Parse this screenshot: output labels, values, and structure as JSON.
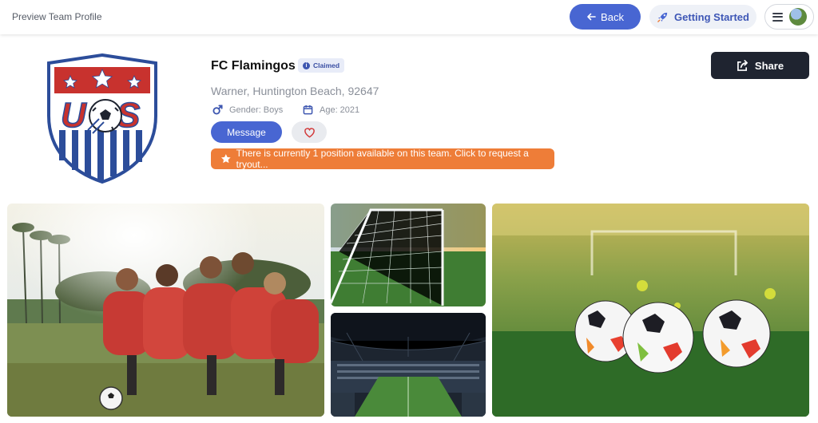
{
  "header": {
    "title": "Preview Team Profile",
    "back_label": "Back",
    "getting_started_label": "Getting Started"
  },
  "team": {
    "name": "FC Flamingos",
    "claimed_label": "Claimed",
    "location": "Warner, Huntington Beach, 92647",
    "gender": "Gender: Boys",
    "age": "Age: 2021",
    "crest_text": "US"
  },
  "actions": {
    "message_label": "Message",
    "share_label": "Share",
    "tryout_text": "There is currently 1 position available on this team. Click to request a tryout..."
  },
  "colors": {
    "primary": "#4866d2",
    "accent_orange": "#ee7d38",
    "dark": "#1f2430",
    "crest_red": "#c8322e",
    "crest_blue": "#2c4d9a"
  }
}
